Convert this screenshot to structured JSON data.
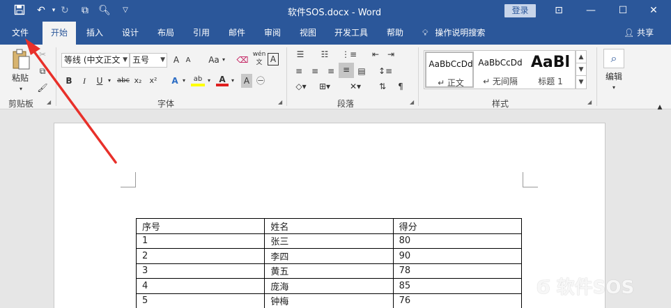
{
  "window": {
    "title": "软件SOS.docx  -  Word",
    "login_label": "登录",
    "colors": {
      "accent": "#2b579a",
      "ribbon_bg": "#f3f3f3",
      "arrow": "#e8302a"
    }
  },
  "quick_access": {
    "icons": [
      "save-icon",
      "undo-icon",
      "redo-icon",
      "touch-mode-icon",
      "print-preview-icon",
      "customize-icon"
    ]
  },
  "tabs": [
    "文件",
    "开始",
    "插入",
    "设计",
    "布局",
    "引用",
    "邮件",
    "审阅",
    "视图",
    "开发工具",
    "帮助"
  ],
  "active_tab": "开始",
  "tell_me": "操作说明搜索",
  "share": "共享",
  "ribbon": {
    "clipboard": {
      "paste": "粘贴",
      "group": "剪贴板"
    },
    "font": {
      "font_name": "等线 (中文正文)",
      "font_size": "五号",
      "group": "字体",
      "aa_label": "Aa",
      "grow": "A",
      "shrink": "A",
      "bold": "B",
      "italic": "I",
      "underline": "U",
      "strike": "abc",
      "sub": "x₂",
      "sup": "x²",
      "phonetic": "wén",
      "phonetic2": "文"
    },
    "paragraph": {
      "group": "段落"
    },
    "styles": {
      "group": "样式",
      "items": [
        {
          "sample": "AaBbCcDd",
          "name": "↵ 正文"
        },
        {
          "sample": "AaBbCcDd",
          "name": "↵ 无间隔"
        },
        {
          "sample": "AaBl",
          "name": "标题 1"
        }
      ]
    },
    "editing": {
      "label": "编辑"
    }
  },
  "table": {
    "headers": [
      "序号",
      "姓名",
      "得分"
    ],
    "rows": [
      [
        "1",
        "张三",
        "80"
      ],
      [
        "2",
        "李四",
        "90"
      ],
      [
        "3",
        "黄五",
        "78"
      ],
      [
        "4",
        "庞海",
        "85"
      ],
      [
        "5",
        "钟梅",
        "76"
      ]
    ]
  },
  "watermark": "软件SOS"
}
